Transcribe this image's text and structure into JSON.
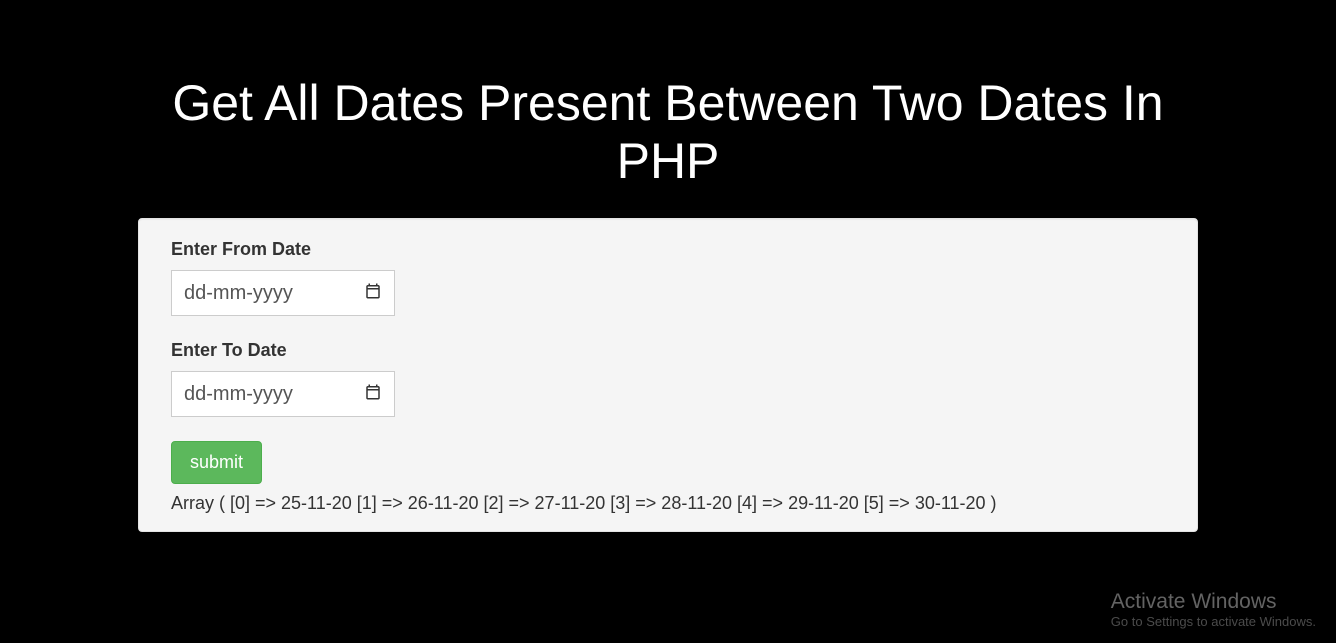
{
  "header": {
    "title": "Get All Dates Present Between Two Dates In PHP"
  },
  "form": {
    "from_label": "Enter From Date",
    "from_placeholder": "dd-mm-yyyy",
    "to_label": "Enter To Date",
    "to_placeholder": "dd-mm-yyyy",
    "submit_label": "submit"
  },
  "output": {
    "text": "Array ( [0] => 25-11-20 [1] => 26-11-20 [2] => 27-11-20 [3] => 28-11-20 [4] => 29-11-20 [5] => 30-11-20 )"
  },
  "watermark": {
    "title": "Activate Windows",
    "subtitle": "Go to Settings to activate Windows."
  }
}
